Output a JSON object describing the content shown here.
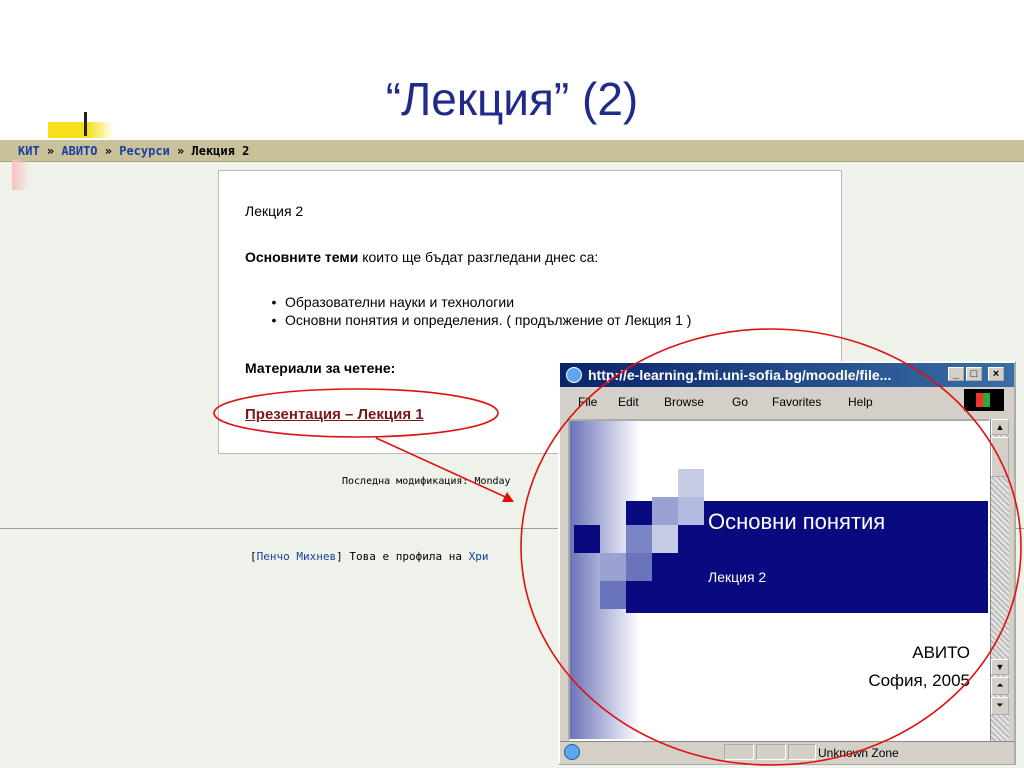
{
  "slide": {
    "title": "“Лекция” (2)"
  },
  "breadcrumb": {
    "items": [
      "КИТ",
      "АВИТО",
      "Ресурси",
      "Лекция 2"
    ],
    "separator": "»"
  },
  "content": {
    "lecture_title": "Лекция 2",
    "topics_bold": "Основните теми",
    "topics_rest": " които ще бъдат разгледани днес са:",
    "topics": [
      "Образователни науки и технологии",
      "Основни понятия и определения. ( продължение от Лекция 1 )"
    ],
    "readings_heading": "Материали за четене:",
    "presentation_link": "Презентация – Лекция 1"
  },
  "footer": {
    "last_modified": "Последна модификация: Monday",
    "profile_name": "Пенчо Михнев",
    "profile_text": " Това е профила на ",
    "profile_link": "Хри"
  },
  "browser": {
    "title": "http://e-learning.fmi.uni-sofia.bg/moodle/file...",
    "menu": [
      "File",
      "Edit",
      "Browse",
      "Go",
      "Favorites",
      "Help"
    ],
    "status_zone": "Unknown Zone"
  },
  "embedded_slide": {
    "heading": "Основни понятия",
    "subheading": "Лекция 2",
    "org": "АВИТО",
    "place_year": "София, 2005"
  },
  "colors": {
    "title": "#1f2a8a",
    "breadcrumb_bg": "#c9c19a",
    "page_bg": "#eef2ea",
    "link": "#1a3fa0",
    "presentation_link": "#7a1818",
    "slide_band": "#0a0a80",
    "annotation": "#e01010"
  }
}
